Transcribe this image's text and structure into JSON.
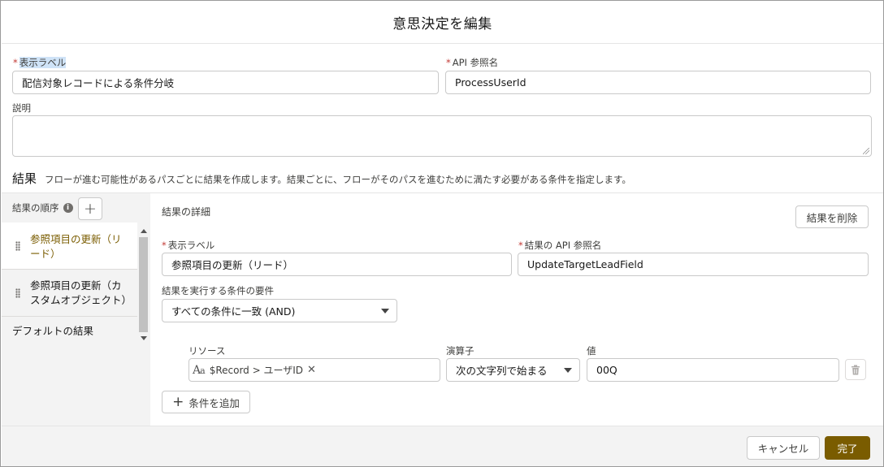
{
  "modal": {
    "title": "意思決定を編集",
    "display_label": {
      "label": "表示ラベル",
      "value": "配信対象レコードによる条件分岐"
    },
    "api_name": {
      "label": "API 参照名",
      "value": "ProcessUserId"
    },
    "description": {
      "label": "説明",
      "value": ""
    },
    "required_mark": "*"
  },
  "outcomes": {
    "title": "結果",
    "description": "フローが進む可能性があるパスごとに結果を作成します。結果ごとに、フローがそのパスを進むために満たす必要がある条件を指定します。",
    "order_label": "結果の順序",
    "info_icon": "info-icon",
    "add_button": "+",
    "items": [
      {
        "label": "参照項目の更新（リード）",
        "active": true
      },
      {
        "label": "参照項目の更新（カスタムオブジェクト）",
        "active": false
      },
      {
        "label": "デフォルトの結果",
        "active": false
      }
    ]
  },
  "detail": {
    "heading": "結果の詳細",
    "delete_button": "結果を削除",
    "display_label": {
      "label": "表示ラベル",
      "value": "参照項目の更新（リード）"
    },
    "api_name": {
      "label": "結果の API 参照名",
      "value": "UpdateTargetLeadField"
    },
    "requirement": {
      "label": "結果を実行する条件の要件",
      "value": "すべての条件に一致 (AND)"
    },
    "condition": {
      "resource_label": "リソース",
      "resource_value": "$Record > ユーザID",
      "operator_label": "演算子",
      "operator_value": "次の文字列で始まる",
      "value_label": "値",
      "value_value": "00Q"
    },
    "add_condition_button": "条件を追加"
  },
  "footer": {
    "cancel": "キャンセル",
    "done": "完了"
  },
  "colors": {
    "brand": "#7a5c00",
    "required": "#c23934"
  }
}
